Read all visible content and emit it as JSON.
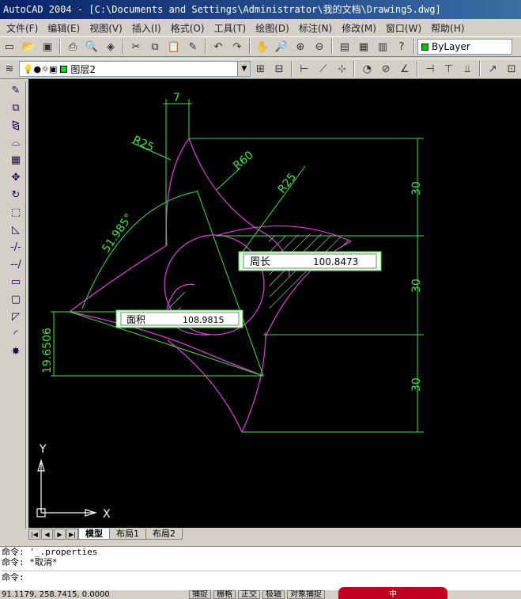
{
  "window": {
    "title": "AutoCAD 2004 - [C:\\Documents and Settings\\Administrator\\我的文档\\Drawing5.dwg]"
  },
  "menu": {
    "items": [
      "文件(F)",
      "编辑(E)",
      "视图(V)",
      "插入(I)",
      "格式(O)",
      "工具(T)",
      "绘图(D)",
      "标注(N)",
      "修改(M)",
      "窗口(W)",
      "帮助(H)"
    ]
  },
  "toolbar": {
    "linetype_value": "ByLayer",
    "layer_value": "图层2"
  },
  "drawing": {
    "dims": {
      "top": "7",
      "r25_left": "R25",
      "r60": "R60",
      "r25_right": "R25",
      "angle": "51.985°",
      "left_height": "19.6506",
      "v1": "30",
      "v2": "30",
      "v3": "30"
    },
    "tooltip_perimeter": {
      "label": "周长",
      "value": "100.8473"
    },
    "tooltip_area": {
      "label": "面积",
      "value": "108.9815"
    },
    "ucs": {
      "x": "X",
      "y": "Y"
    }
  },
  "tabs": {
    "model": "模型",
    "layout1": "布局1",
    "layout2": "布局2"
  },
  "command": {
    "line1": "命令: '_.properties",
    "line2": "命令: *取消*",
    "prompt": "命令:"
  },
  "status": {
    "coords": "91.1179, 258.7415, 0.0000",
    "buttons": [
      "捕捉",
      "栅格",
      "正交",
      "极轴",
      "对象捕捉"
    ],
    "ime": "中"
  },
  "colors": {
    "magenta": "#e040e0",
    "green": "#40e040",
    "white": "#ffffff"
  }
}
